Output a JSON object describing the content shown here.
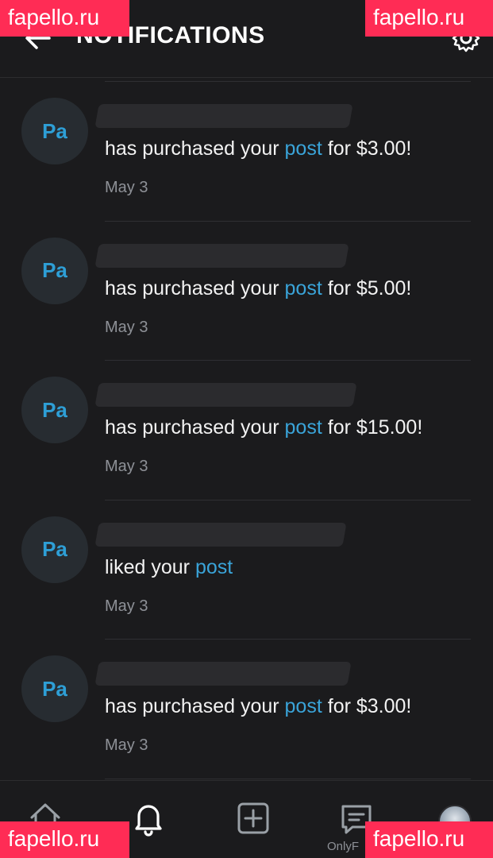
{
  "header": {
    "title": "NOTIFICATIONS",
    "back_icon": "arrow-left-icon",
    "settings_icon": "gear-icon"
  },
  "colors": {
    "background": "#1b1b1d",
    "accent_link": "#3aa4d9",
    "avatar_bg": "#272c31",
    "watermark": "#ff2c55"
  },
  "notifications": [
    {
      "avatar_initials": "Pa",
      "pre": "has purchased your ",
      "link": "post",
      "post": " for $3.00!",
      "date": "May 3"
    },
    {
      "avatar_initials": "Pa",
      "pre": "has purchased your ",
      "link": "post",
      "post": " for $5.00!",
      "date": "May 3"
    },
    {
      "avatar_initials": "Pa",
      "pre": "has purchased your ",
      "link": "post",
      "post": " for $15.00!",
      "date": "May 3"
    },
    {
      "avatar_initials": "Pa",
      "pre": "liked your ",
      "link": "post",
      "post": "",
      "date": "May 3"
    },
    {
      "avatar_initials": "Pa",
      "pre": "has purchased your ",
      "link": "post",
      "post": " for $3.00!",
      "date": "May 3"
    }
  ],
  "bottom_nav": {
    "items": [
      "home-icon",
      "bell-icon",
      "add-icon",
      "chat-icon",
      "profile-avatar"
    ],
    "label": "OnlyF"
  },
  "watermarks": {
    "top_left": "fapello.ru",
    "top_right": "fapello.ru",
    "bottom_left": "fapello.ru",
    "bottom_right": "fapello.ru"
  }
}
